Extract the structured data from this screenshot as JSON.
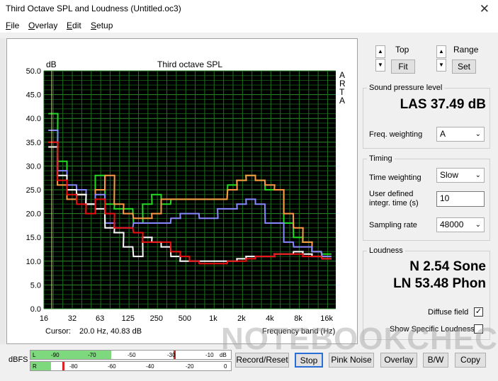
{
  "window": {
    "title": "Third Octave SPL and Loudness (Untitled.oc3)",
    "close_glyph": "✕"
  },
  "menu": [
    "File",
    "Overlay",
    "Edit",
    "Setup"
  ],
  "plot": {
    "title": "Third octave SPL",
    "y_unit": "dB",
    "right_label": [
      "A",
      "R",
      "T",
      "A"
    ],
    "cursor_label": "Cursor:",
    "cursor_value": "20.0 Hz, 40.83 dB",
    "x_axis_label": "Frequency band (Hz)"
  },
  "chart_data": {
    "type": "line",
    "xlabel": "Frequency band (Hz)",
    "ylabel": "dB",
    "title": "Third octave SPL",
    "ylim": [
      0,
      50
    ],
    "y_ticks": [
      "0.0",
      "5.0",
      "10.0",
      "15.0",
      "20.0",
      "25.0",
      "30.0",
      "35.0",
      "40.0",
      "45.0",
      "50.0"
    ],
    "x_tick_labels": [
      "16",
      "32",
      "63",
      "125",
      "250",
      "500",
      "1k",
      "2k",
      "4k",
      "8k",
      "16k"
    ],
    "x_bands": [
      20,
      25,
      31.5,
      40,
      50,
      63,
      80,
      100,
      125,
      160,
      200,
      250,
      315,
      400,
      500,
      630,
      800,
      1000,
      1250,
      1600,
      2000,
      2500,
      3150,
      4000,
      5000,
      6300,
      8000,
      10000,
      12500,
      16000
    ],
    "series": [
      {
        "color": "#22dd22",
        "values": [
          41,
          31,
          25,
          24,
          22,
          28,
          22,
          21,
          21,
          18,
          22,
          24,
          22,
          23,
          23,
          23,
          23,
          23,
          23,
          26,
          27,
          28,
          27,
          25,
          25,
          18,
          15,
          14,
          12,
          11.5
        ]
      },
      {
        "color": "#ff9a44",
        "values": [
          35,
          26,
          23,
          24,
          22,
          25,
          28,
          22,
          20,
          19,
          19,
          20,
          23,
          23,
          23,
          23,
          23,
          23,
          23,
          25,
          27,
          28,
          27,
          26,
          25,
          20,
          17,
          14,
          12,
          11
        ]
      },
      {
        "color": "#8888ff",
        "values": [
          37.5,
          29,
          26,
          25,
          22,
          24,
          18,
          17,
          17,
          18,
          18,
          18,
          18,
          19,
          20,
          20,
          19,
          19,
          21,
          21,
          22,
          23,
          22,
          18,
          18,
          14,
          13,
          13,
          12,
          11
        ]
      },
      {
        "color": "#ffffff",
        "values": [
          34,
          28,
          25,
          24,
          22,
          21,
          17,
          16,
          13,
          11,
          15,
          14,
          13,
          11,
          10,
          10,
          10,
          10,
          10,
          10,
          10.5,
          11,
          11,
          11,
          11.5,
          11.5,
          12,
          11.5,
          11,
          10.5
        ]
      },
      {
        "color": "#ee1111",
        "values": [
          35,
          27,
          24,
          22,
          20,
          23,
          20,
          17,
          17,
          16,
          14,
          14,
          14,
          12,
          11,
          10,
          9.5,
          9.5,
          9.5,
          10,
          10,
          10.5,
          11,
          11,
          11.5,
          11.5,
          11.5,
          11,
          11,
          10.5
        ]
      }
    ]
  },
  "top_controls": {
    "top_label": "Top",
    "fit_label": "Fit",
    "range_label": "Range",
    "set_label": "Set"
  },
  "spl_group": {
    "title": "Sound pressure level",
    "value": "LAS 37.49 dB",
    "freq_weighting_label": "Freq. weighting",
    "freq_weighting_value": "A"
  },
  "timing_group": {
    "title": "Timing",
    "time_weighting_label": "Time weighting",
    "time_weighting_value": "Slow",
    "user_time_label_1": "User defined",
    "user_time_label_2": "integr. time (s)",
    "user_time_value": "10",
    "sampling_rate_label": "Sampling rate",
    "sampling_rate_value": "48000"
  },
  "loudness_group": {
    "title": "Loudness",
    "sone": "N 2.54 Sone",
    "phon": "LN 53.48 Phon",
    "diffuse_label": "Diffuse field",
    "diffuse_checked": "✓",
    "specific_label": "Show Specific Loudness"
  },
  "bottom": {
    "dbfs_label": "dBFS",
    "meter_L_label": "L",
    "meter_R_label": "R",
    "meter_L_ticks": [
      "-90",
      "-70",
      "-50",
      "-30",
      "-10",
      "dB"
    ],
    "meter_R_ticks": [
      "-80",
      "-60",
      "-40",
      "-20",
      "0"
    ],
    "meter_L_level": 0.4,
    "meter_R_level": 0.1,
    "buttons": [
      "Record/Reset",
      "Stop",
      "Pink Noise",
      "Overlay",
      "B/W",
      "Copy"
    ]
  },
  "watermark": "NOTEBOOKCHECK",
  "colors": {
    "plot_bg": "#000000",
    "grid": "#1a7a1a"
  }
}
